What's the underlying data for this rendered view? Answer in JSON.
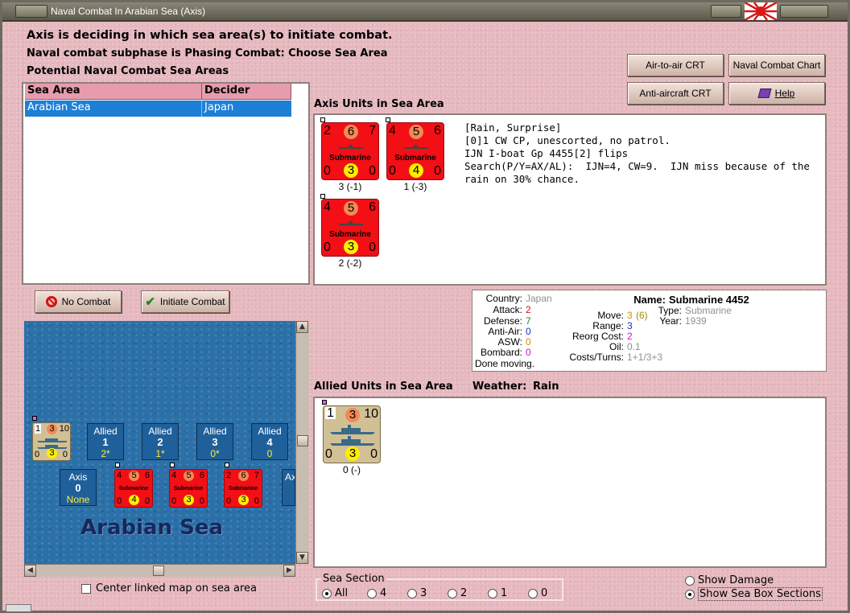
{
  "window": {
    "title": "Naval Combat In Arabian Sea (Axis)"
  },
  "header": {
    "line1": "Axis is deciding in which sea area(s) to initiate combat.",
    "line2": "Naval combat subphase is Phasing Combat: Choose Sea Area",
    "line3": "Potential Naval Combat Sea Areas"
  },
  "buttons": {
    "air_to_air": "Air-to-air CRT",
    "naval_chart": "Naval Combat Chart",
    "anti_aircraft": "Anti-aircraft CRT",
    "help": "Help",
    "no_combat": "No Combat",
    "initiate_combat": "Initiate Combat"
  },
  "sea_area_table": {
    "headers": [
      "Sea Area",
      "Decider"
    ],
    "rows": [
      {
        "sea_area": "Arabian Sea",
        "decider": "Japan",
        "selected": true
      }
    ]
  },
  "axis_units": {
    "title": "Axis Units in Sea Area",
    "counters": [
      {
        "attack": "2",
        "move": "6",
        "range": "7",
        "type": "Submarine",
        "left": "0",
        "defense": "3",
        "right": "0",
        "caption": "3 (-1)"
      },
      {
        "attack": "4",
        "move": "5",
        "range": "6",
        "type": "Submarine",
        "left": "0",
        "defense": "4",
        "right": "0",
        "caption": "1 (-3)"
      },
      {
        "attack": "4",
        "move": "5",
        "range": "6",
        "type": "Submarine",
        "left": "0",
        "defense": "3",
        "right": "0",
        "caption": "2 (-2)"
      }
    ],
    "report": "[Rain, Surprise]\n[0]1 CW CP, unescorted, no patrol.\nIJN I-boat Gp 4455[2] flips\nSearch(P/Y=AX/AL):  IJN=4, CW=9.  IJN miss because of the\nrain on 30% chance."
  },
  "unit_info": {
    "country_label": "Country:",
    "country": "Japan",
    "attack_label": "Attack:",
    "attack": "2",
    "defense_label": "Defense:",
    "defense": "7",
    "antiair_label": "Anti-Air:",
    "antiair": "0",
    "asw_label": "ASW:",
    "asw": "0",
    "bombard_label": "Bombard:",
    "bombard": "0",
    "status": "Done moving.",
    "name_label": "Name:",
    "name": "Submarine 4452",
    "move_label": "Move:",
    "move": "3",
    "move_extra": "(6)",
    "type_label": "Type:",
    "type": "Submarine",
    "range_label": "Range:",
    "range": "3",
    "year_label": "Year:",
    "year": "1939",
    "reorg_label": "Reorg Cost:",
    "reorg": "2",
    "oil_label": "Oil:",
    "oil": "0.1",
    "costs_label": "Costs/Turns:",
    "costs": "1+1/3+3"
  },
  "allied_units": {
    "title": "Allied Units in Sea Area",
    "weather_label": "Weather:",
    "weather": "Rain",
    "counters": [
      {
        "attack": "1",
        "move": "3",
        "range": "10",
        "left": "0",
        "defense": "3",
        "right": "0",
        "caption": "0 (-)"
      }
    ]
  },
  "map": {
    "sea_name": "Arabian Sea",
    "allied_boxes": [
      {
        "label": "Allied",
        "num": "1",
        "sub": "2*"
      },
      {
        "label": "Allied",
        "num": "2",
        "sub": "1*"
      },
      {
        "label": "Allied",
        "num": "3",
        "sub": "0*"
      },
      {
        "label": "Allied",
        "num": "4",
        "sub": "0"
      }
    ],
    "axis_box": {
      "label": "Axis",
      "num": "0",
      "sub": "None"
    },
    "axis_box_partial": "Ax",
    "mini_allied": {
      "a": "1",
      "m": "3",
      "r": "10",
      "l": "0",
      "d": "3",
      "rr": "0"
    },
    "mini_axis": [
      {
        "a": "4",
        "m": "5",
        "r": "6",
        "type": "Submarine",
        "l": "0",
        "d": "4",
        "rr": "0"
      },
      {
        "a": "4",
        "m": "5",
        "r": "6",
        "type": "Submarine",
        "l": "0",
        "d": "3",
        "rr": "0"
      },
      {
        "a": "2",
        "m": "6",
        "r": "7",
        "type": "Submarine",
        "l": "0",
        "d": "3",
        "rr": "0"
      }
    ],
    "center_linked_label": "Center linked map on sea area"
  },
  "sea_section": {
    "legend": "Sea Section",
    "options": [
      "All",
      "4",
      "3",
      "2",
      "1",
      "0"
    ],
    "selected": "All"
  },
  "display_options": {
    "show_damage": "Show Damage",
    "show_sea_box_sections": "Show Sea Box Sections",
    "selected": "Show Sea Box Sections"
  },
  "colors": {
    "axis_counter": "#f20f15",
    "allied_counter": "#d2c095",
    "table_header": "#e79cad",
    "selection": "#1e7fd6",
    "sea": "#2c70a8",
    "value_red": "#e01010",
    "value_green": "#1a8a1a",
    "value_blue": "#1030d0",
    "value_orange": "#d88a00",
    "value_magenta": "#d010d0",
    "value_olive": "#a08a10",
    "value_grey": "#909090"
  },
  "icons": {
    "no_combat": "no-entry-icon",
    "initiate_combat": "checkmark-icon",
    "help": "book-icon",
    "flag": "rising-sun-flag-icon"
  }
}
